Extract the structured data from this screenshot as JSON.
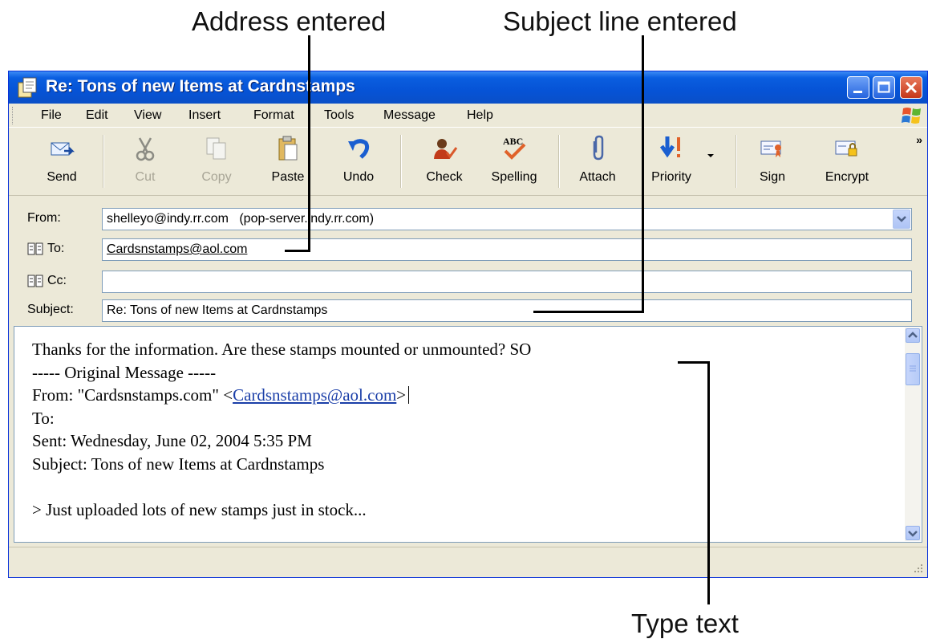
{
  "callouts": {
    "address": "Address entered",
    "subject": "Subject line entered",
    "type_text": "Type text"
  },
  "window": {
    "title": "Re: Tons of new Items at Cardnstamps"
  },
  "menu": [
    "File",
    "Edit",
    "View",
    "Insert",
    "Format",
    "Tools",
    "Message",
    "Help"
  ],
  "toolbar": {
    "send": "Send",
    "cut": "Cut",
    "copy": "Copy",
    "paste": "Paste",
    "undo": "Undo",
    "check": "Check",
    "spelling": "Spelling",
    "attach": "Attach",
    "priority": "Priority",
    "sign": "Sign",
    "encrypt": "Encrypt",
    "more": "»"
  },
  "header": {
    "from_label": "From:",
    "from_value": "shelleyo@indy.rr.com   (pop-server.indy.rr.com)",
    "to_label": "To:",
    "to_value": "Cardsnstamps@aol.com",
    "cc_label": "Cc:",
    "cc_value": "",
    "subject_label": "Subject:",
    "subject_value": "Re: Tons of new Items at Cardnstamps"
  },
  "message": {
    "line1": "Thanks for the information. Are these stamps mounted or unmounted? SO",
    "line2": "----- Original Message -----",
    "from_prefix": "From: \"Cardsnstamps.com\" <",
    "from_link": "Cardsnstamps@aol.com",
    "from_suffix": ">",
    "to_line": "To:",
    "sent_line": "Sent: Wednesday, June 02, 2004 5:35 PM",
    "subject_line": "Subject: Tons of new Items at Cardnstamps",
    "blank": "",
    "quote_line": "> Just uploaded lots of new stamps just in stock..."
  },
  "colors": {
    "titlebar": "#0653d6",
    "window_face": "#ece9d8",
    "link": "#1a3ea8"
  }
}
